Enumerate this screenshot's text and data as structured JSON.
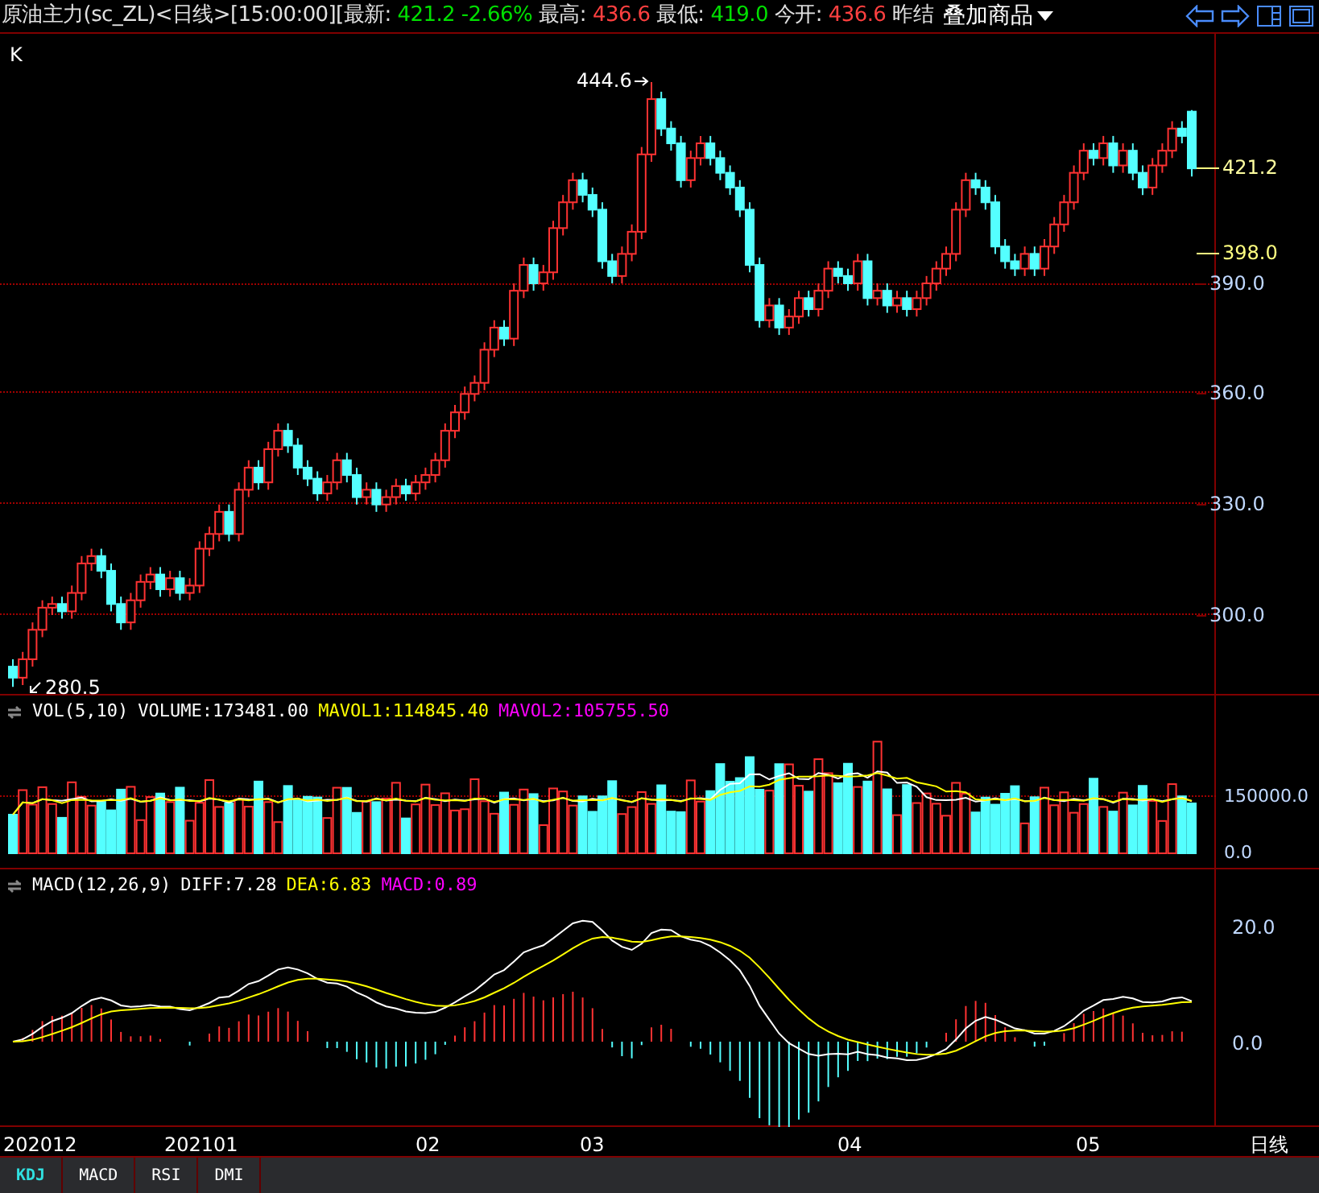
{
  "header": {
    "segments": [
      {
        "text": "原油主力(sc_ZL)<日线>[15:00:00][最新:",
        "color": "#e0e0e0"
      },
      {
        "text": "421.2 -2.66%",
        "color": "#00e000"
      },
      {
        "text": "最高:",
        "color": "#e0e0e0"
      },
      {
        "text": "436.6",
        "color": "#ff4040"
      },
      {
        "text": "最低:",
        "color": "#e0e0e0"
      },
      {
        "text": "419.0",
        "color": "#00e000"
      },
      {
        "text": "今开:",
        "color": "#e0e0e0"
      },
      {
        "text": "436.6",
        "color": "#ff4040"
      },
      {
        "text": "昨结",
        "color": "#e0e0e0"
      }
    ],
    "overlay_button": "叠加商品"
  },
  "price_panel": {
    "title": "K",
    "high_marker": "444.6",
    "low_marker": "280.5",
    "price_labels": [
      {
        "text": "421.2",
        "kind": "last"
      },
      {
        "text": "398.0",
        "kind": "settle"
      },
      {
        "text": "390.0",
        "kind": "grid"
      },
      {
        "text": "360.0",
        "kind": "grid"
      },
      {
        "text": "330.0",
        "kind": "grid"
      },
      {
        "text": "300.0",
        "kind": "grid"
      }
    ],
    "chart_data": {
      "type": "candlestick",
      "ohlc": [
        [
          286,
          288,
          280.5,
          283
        ],
        [
          283,
          290,
          281,
          288
        ],
        [
          288,
          298,
          286,
          296
        ],
        [
          296,
          304,
          294,
          302
        ],
        [
          302,
          305,
          300,
          303
        ],
        [
          303,
          305,
          299,
          301
        ],
        [
          301,
          308,
          299,
          306
        ],
        [
          306,
          316,
          304,
          314
        ],
        [
          314,
          318,
          312,
          316
        ],
        [
          316,
          318,
          310,
          312
        ],
        [
          312,
          314,
          301,
          303
        ],
        [
          303,
          305,
          296,
          298
        ],
        [
          298,
          306,
          296,
          304
        ],
        [
          304,
          311,
          302,
          309
        ],
        [
          309,
          313,
          307,
          311
        ],
        [
          311,
          313,
          305,
          307
        ],
        [
          307,
          312,
          305,
          310
        ],
        [
          310,
          312,
          304,
          306
        ],
        [
          306,
          310,
          304,
          308
        ],
        [
          308,
          320,
          306,
          318
        ],
        [
          318,
          324,
          316,
          322
        ],
        [
          322,
          330,
          320,
          328
        ],
        [
          328,
          330,
          320,
          322
        ],
        [
          322,
          336,
          320,
          334
        ],
        [
          334,
          342,
          332,
          340
        ],
        [
          340,
          342,
          334,
          336
        ],
        [
          336,
          347,
          334,
          345
        ],
        [
          345,
          352,
          343,
          350
        ],
        [
          350,
          352,
          344,
          346
        ],
        [
          346,
          348,
          338,
          340
        ],
        [
          340,
          342,
          335,
          337
        ],
        [
          337,
          339,
          331,
          333
        ],
        [
          333,
          338,
          331,
          336
        ],
        [
          336,
          344,
          334,
          342
        ],
        [
          342,
          344,
          336,
          338
        ],
        [
          338,
          340,
          330,
          332
        ],
        [
          332,
          336,
          330,
          334
        ],
        [
          334,
          336,
          328,
          330
        ],
        [
          330,
          334,
          328,
          332
        ],
        [
          332,
          337,
          330,
          335
        ],
        [
          335,
          337,
          331,
          333
        ],
        [
          333,
          338,
          331,
          336
        ],
        [
          336,
          340,
          334,
          338
        ],
        [
          338,
          344,
          336,
          342
        ],
        [
          342,
          352,
          340,
          350
        ],
        [
          350,
          357,
          348,
          355
        ],
        [
          355,
          362,
          353,
          360
        ],
        [
          360,
          365,
          358,
          363
        ],
        [
          363,
          374,
          361,
          372
        ],
        [
          372,
          380,
          370,
          378
        ],
        [
          378,
          380,
          373,
          375
        ],
        [
          375,
          390,
          373,
          388
        ],
        [
          388,
          397,
          386,
          395
        ],
        [
          395,
          397,
          388,
          390
        ],
        [
          390,
          395,
          388,
          393
        ],
        [
          393,
          407,
          391,
          405
        ],
        [
          405,
          414,
          403,
          412
        ],
        [
          412,
          420,
          410,
          418
        ],
        [
          418,
          420,
          412,
          414
        ],
        [
          414,
          416,
          408,
          410
        ],
        [
          410,
          412,
          394,
          396
        ],
        [
          396,
          398,
          390,
          392
        ],
        [
          392,
          400,
          390,
          398
        ],
        [
          398,
          406,
          396,
          404
        ],
        [
          404,
          427,
          402,
          425
        ],
        [
          425,
          444.6,
          423,
          440
        ],
        [
          440,
          442,
          430,
          432
        ],
        [
          432,
          434,
          426,
          428
        ],
        [
          428,
          430,
          416,
          418
        ],
        [
          418,
          426,
          416,
          424
        ],
        [
          424,
          430,
          422,
          428
        ],
        [
          428,
          430,
          422,
          424
        ],
        [
          424,
          426,
          418,
          420
        ],
        [
          420,
          422,
          414,
          416
        ],
        [
          416,
          418,
          408,
          410
        ],
        [
          410,
          412,
          393,
          395
        ],
        [
          395,
          397,
          378,
          380
        ],
        [
          380,
          386,
          378,
          384
        ],
        [
          384,
          386,
          376,
          378
        ],
        [
          378,
          383,
          376,
          381
        ],
        [
          381,
          388,
          379,
          386
        ],
        [
          386,
          388,
          381,
          383
        ],
        [
          383,
          390,
          381,
          388
        ],
        [
          388,
          396,
          386,
          394
        ],
        [
          394,
          396,
          390,
          392
        ],
        [
          392,
          394,
          388,
          390
        ],
        [
          390,
          398,
          388,
          396
        ],
        [
          396,
          398,
          384,
          386
        ],
        [
          386,
          390,
          384,
          388
        ],
        [
          388,
          390,
          382,
          384
        ],
        [
          384,
          388,
          382,
          386
        ],
        [
          386,
          388,
          381,
          383
        ],
        [
          383,
          388,
          381,
          386
        ],
        [
          386,
          392,
          384,
          390
        ],
        [
          390,
          396,
          388,
          394
        ],
        [
          394,
          400,
          392,
          398
        ],
        [
          398,
          412,
          396,
          410
        ],
        [
          410,
          420,
          408,
          418
        ],
        [
          418,
          420,
          414,
          416
        ],
        [
          416,
          418,
          410,
          412
        ],
        [
          412,
          414,
          398,
          400
        ],
        [
          400,
          402,
          394,
          396
        ],
        [
          396,
          398,
          392,
          394
        ],
        [
          394,
          400,
          392,
          398
        ],
        [
          398,
          400,
          392,
          394
        ],
        [
          394,
          402,
          392,
          400
        ],
        [
          400,
          408,
          398,
          406
        ],
        [
          406,
          414,
          404,
          412
        ],
        [
          412,
          422,
          410,
          420
        ],
        [
          420,
          428,
          418,
          426
        ],
        [
          426,
          428,
          422,
          424
        ],
        [
          424,
          430,
          422,
          428
        ],
        [
          428,
          430,
          420,
          422
        ],
        [
          422,
          428,
          420,
          426
        ],
        [
          426,
          428,
          418,
          420
        ],
        [
          420,
          422,
          414,
          416
        ],
        [
          416,
          424,
          414,
          422
        ],
        [
          422,
          428,
          420,
          426
        ],
        [
          426,
          434,
          424,
          432
        ],
        [
          432,
          434,
          428,
          430
        ],
        [
          436.6,
          437,
          419,
          421.2
        ]
      ]
    }
  },
  "volume_panel": {
    "label": "VOL(5,10)",
    "volume": "VOLUME:173481.00",
    "mavol1": "MAVOL1:114845.40",
    "mavol2": "MAVOL2:105755.50",
    "axis": [
      "150000.0",
      "0.0"
    ]
  },
  "macd_panel": {
    "label": "MACD(12,26,9)",
    "diff": "DIFF:7.28",
    "dea": "DEA:6.83",
    "macd": "MACD:0.89",
    "axis": [
      "20.0",
      "0.0"
    ]
  },
  "x_axis": {
    "labels": [
      "202012",
      "202101",
      "02",
      "03",
      "04",
      "05"
    ],
    "period": "日线"
  },
  "tabs": [
    {
      "label": "KDJ",
      "selected": true
    },
    {
      "label": "MACD",
      "selected": false
    },
    {
      "label": "RSI",
      "selected": false
    },
    {
      "label": "DMI",
      "selected": false
    }
  ]
}
